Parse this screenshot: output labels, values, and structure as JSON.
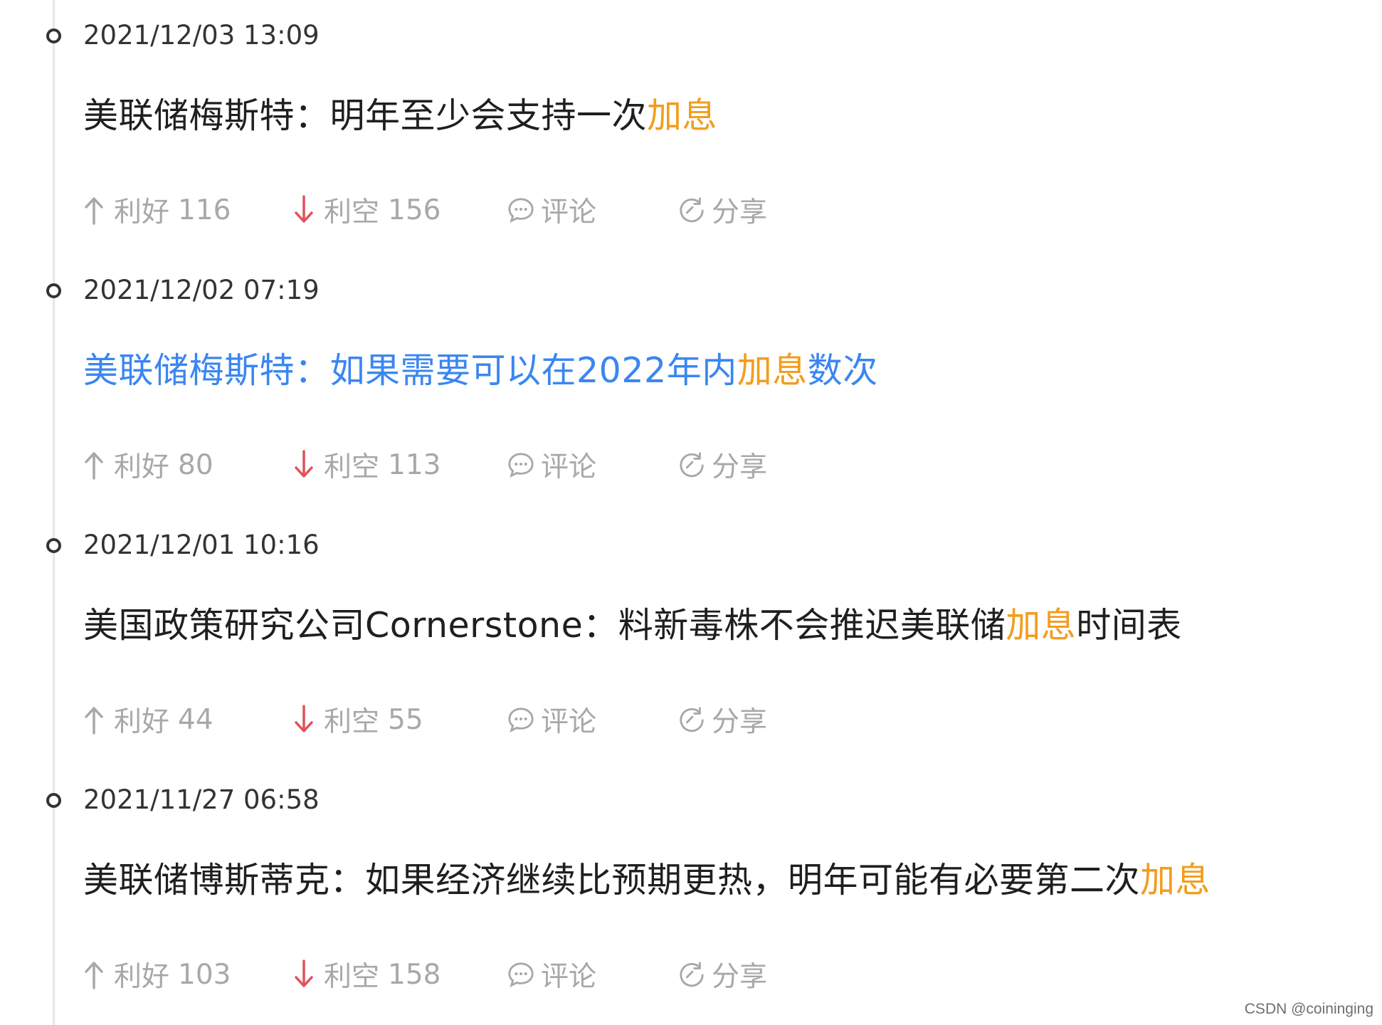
{
  "colors": {
    "text": "#1f1f1f",
    "timestamp": "#333333",
    "muted": "#a8a8a8",
    "highlight": "#f29d1e",
    "link": "#3a86f2",
    "down_arrow": "#e0525c",
    "timeline": "#e6e6e6"
  },
  "icons": {
    "up": "arrow-up-icon",
    "down": "arrow-down-icon",
    "comment": "comment-bubble-icon",
    "share": "share-refresh-icon",
    "timeline_node": "circle-node-icon"
  },
  "entries": [
    {
      "timestamp": "2021/12/03 13:09",
      "headline_pre": "美联储梅斯特：明年至少会支持一次",
      "headline_hl": "加息",
      "headline_post": "",
      "is_link": false,
      "bull_label": "利好",
      "bull_count": "116",
      "bear_label": "利空",
      "bear_count": "156",
      "comment_label": "评论",
      "share_label": "分享"
    },
    {
      "timestamp": "2021/12/02 07:19",
      "headline_pre": "美联储梅斯特：如果需要可以在2022年内",
      "headline_hl": "加息",
      "headline_post": "数次",
      "is_link": true,
      "bull_label": "利好",
      "bull_count": "80",
      "bear_label": "利空",
      "bear_count": "113",
      "comment_label": "评论",
      "share_label": "分享"
    },
    {
      "timestamp": "2021/12/01 10:16",
      "headline_pre": "美国政策研究公司Cornerstone：料新毒株不会推迟美联储",
      "headline_hl": "加息",
      "headline_post": "时间表",
      "is_link": false,
      "bull_label": "利好",
      "bull_count": "44",
      "bear_label": "利空",
      "bear_count": "55",
      "comment_label": "评论",
      "share_label": "分享"
    },
    {
      "timestamp": "2021/11/27 06:58",
      "headline_pre": "美联储博斯蒂克：如果经济继续比预期更热，明年可能有必要第二次",
      "headline_hl": "加息",
      "headline_post": "",
      "is_link": false,
      "bull_label": "利好",
      "bull_count": "103",
      "bear_label": "利空",
      "bear_count": "158",
      "comment_label": "评论",
      "share_label": "分享"
    }
  ],
  "watermark": "CSDN @coininging"
}
